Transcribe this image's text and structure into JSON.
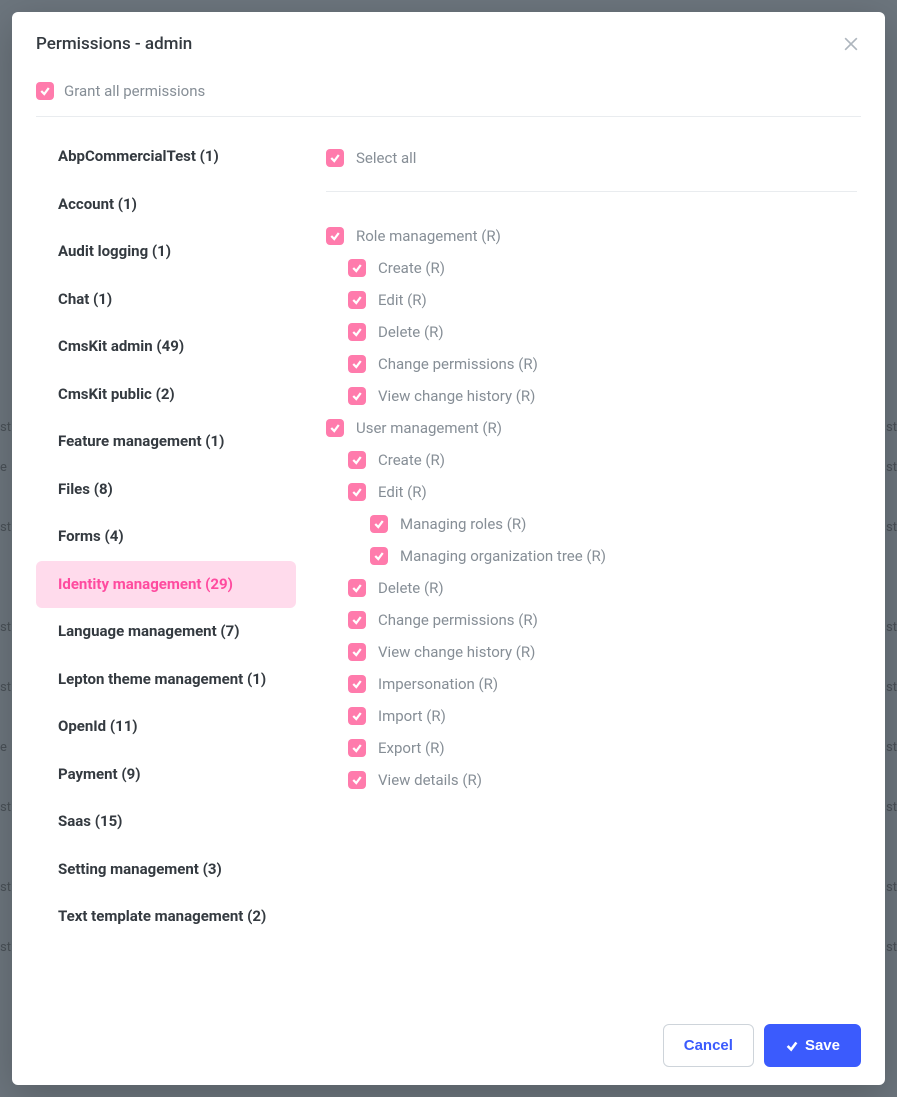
{
  "modal": {
    "title": "Permissions - admin",
    "grant_all_label": "Grant all permissions",
    "select_all_label": "Select all"
  },
  "tabs": [
    {
      "label": "AbpCommercialTest (1)",
      "active": false
    },
    {
      "label": "Account (1)",
      "active": false
    },
    {
      "label": "Audit logging (1)",
      "active": false
    },
    {
      "label": "Chat (1)",
      "active": false
    },
    {
      "label": "CmsKit admin (49)",
      "active": false
    },
    {
      "label": "CmsKit public (2)",
      "active": false
    },
    {
      "label": "Feature management (1)",
      "active": false
    },
    {
      "label": "Files (8)",
      "active": false
    },
    {
      "label": "Forms (4)",
      "active": false
    },
    {
      "label": "Identity management (29)",
      "active": true
    },
    {
      "label": "Language management (7)",
      "active": false
    },
    {
      "label": "Lepton theme management (1)",
      "active": false
    },
    {
      "label": "OpenId (11)",
      "active": false
    },
    {
      "label": "Payment (9)",
      "active": false
    },
    {
      "label": "Saas (15)",
      "active": false
    },
    {
      "label": "Setting management (3)",
      "active": false
    },
    {
      "label": "Text template management (2)",
      "active": false
    }
  ],
  "permissions": [
    {
      "label": "Role management (R)",
      "level": 1
    },
    {
      "label": "Create (R)",
      "level": 2
    },
    {
      "label": "Edit (R)",
      "level": 2
    },
    {
      "label": "Delete (R)",
      "level": 2
    },
    {
      "label": "Change permissions (R)",
      "level": 2
    },
    {
      "label": "View change history (R)",
      "level": 2
    },
    {
      "label": "User management (R)",
      "level": 1
    },
    {
      "label": "Create (R)",
      "level": 2
    },
    {
      "label": "Edit (R)",
      "level": 2
    },
    {
      "label": "Managing roles (R)",
      "level": 3
    },
    {
      "label": "Managing organization tree (R)",
      "level": 3
    },
    {
      "label": "Delete (R)",
      "level": 2
    },
    {
      "label": "Change permissions (R)",
      "level": 2
    },
    {
      "label": "View change history (R)",
      "level": 2
    },
    {
      "label": "Impersonation (R)",
      "level": 2
    },
    {
      "label": "Import (R)",
      "level": 2
    },
    {
      "label": "Export (R)",
      "level": 2
    },
    {
      "label": "View details (R)",
      "level": 2
    }
  ],
  "footer": {
    "cancel": "Cancel",
    "save": "Save"
  }
}
